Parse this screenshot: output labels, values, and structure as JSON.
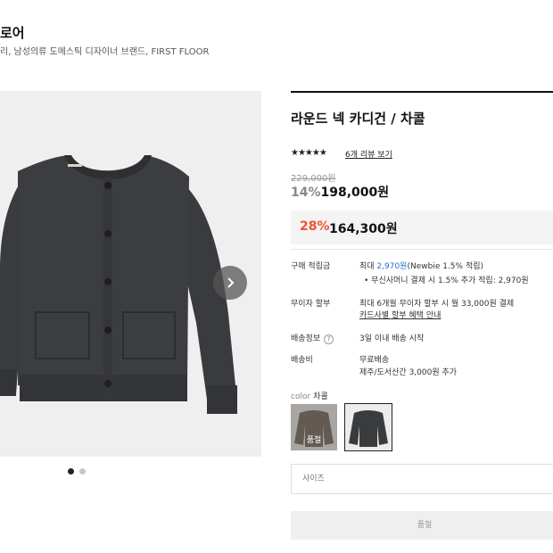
{
  "brand": {
    "title": "로어",
    "description": "리, 남성의류 도메스틱 디자이너 브랜드, FIRST FLOOR"
  },
  "product": {
    "name": "라운드 넥 카디건 / 차콜",
    "rating": 4.5,
    "stars": "★★★★★",
    "review_link": "6개 리뷰 보기",
    "original_price": "229,000원",
    "discount_rate": "14%",
    "discount_price": "198,000원",
    "member_rate": "28%",
    "member_price": "164,300원"
  },
  "details": {
    "points_label": "구매 적립금",
    "points_value_prefix": "최대 ",
    "points_value_amount": "2,970원",
    "points_value_suffix": "(Newbie 1.5% 적립)",
    "points_sub": "무신사머니 결제 시 1.5% 추가 적립: 2,970원",
    "installment_label": "무이자 할부",
    "installment_value": "최대 6개월 무이자 할부 시 월 33,000원 결제",
    "installment_link": "카드사별 할부 혜택 안내",
    "shipping_info_label": "배송정보",
    "shipping_info_help": "?",
    "shipping_info_value": "3일 이내 배송 시작",
    "shipping_fee_label": "배송비",
    "shipping_fee_value": "무료배송",
    "shipping_fee_sub": "제주/도서산간 3,000원 추가"
  },
  "color": {
    "label": "color",
    "selected": "차콜",
    "swatches": [
      {
        "name": "brown",
        "sold_out_label": "품절",
        "color": "#8a7e72"
      },
      {
        "name": "charcoal",
        "color": "#3a3b3d"
      }
    ]
  },
  "size_select": {
    "placeholder": "사이즈"
  },
  "buy_button": {
    "label": "품절"
  },
  "gallery": {
    "active_index": 0,
    "total": 2
  },
  "colors": {
    "accent": "#f0522f",
    "link_blue": "#2b6cd6",
    "knit": "#3b3c3f"
  }
}
